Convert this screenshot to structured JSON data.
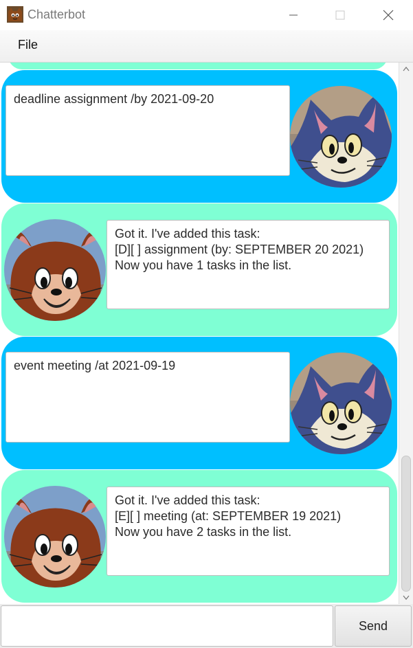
{
  "window": {
    "title": "Chatterbot",
    "icon": "cat-face-icon",
    "controls": [
      "minimize-icon",
      "maximize-icon",
      "close-icon"
    ]
  },
  "menu": {
    "items": [
      {
        "label": "File"
      }
    ]
  },
  "messages": [
    {
      "sender": "user",
      "text": "deadline assignment /by 2021-09-20",
      "avatar": "tom-cat-avatar"
    },
    {
      "sender": "bot",
      "text": "Got it. I've added this task:\n[D][ ] assignment (by: SEPTEMBER 20 2021)\nNow you have 1 tasks in the list.",
      "avatar": "jerry-mouse-avatar"
    },
    {
      "sender": "user",
      "text": "event meeting /at 2021-09-19",
      "avatar": "tom-cat-avatar"
    },
    {
      "sender": "bot",
      "text": "Got it. I've added this task:\n[E][ ] meeting (at: SEPTEMBER 19 2021)\nNow you have 2 tasks in the list.",
      "avatar": "jerry-mouse-avatar"
    }
  ],
  "input": {
    "value": "",
    "placeholder": ""
  },
  "send_button": {
    "label": "Send"
  },
  "colors": {
    "user_bubble": "#00bfff",
    "bot_bubble": "#7fffd4",
    "textbox_bg": "#ffffff",
    "tom_fur": "#4a5a9a",
    "jerry_fur": "#8b3a1a"
  }
}
